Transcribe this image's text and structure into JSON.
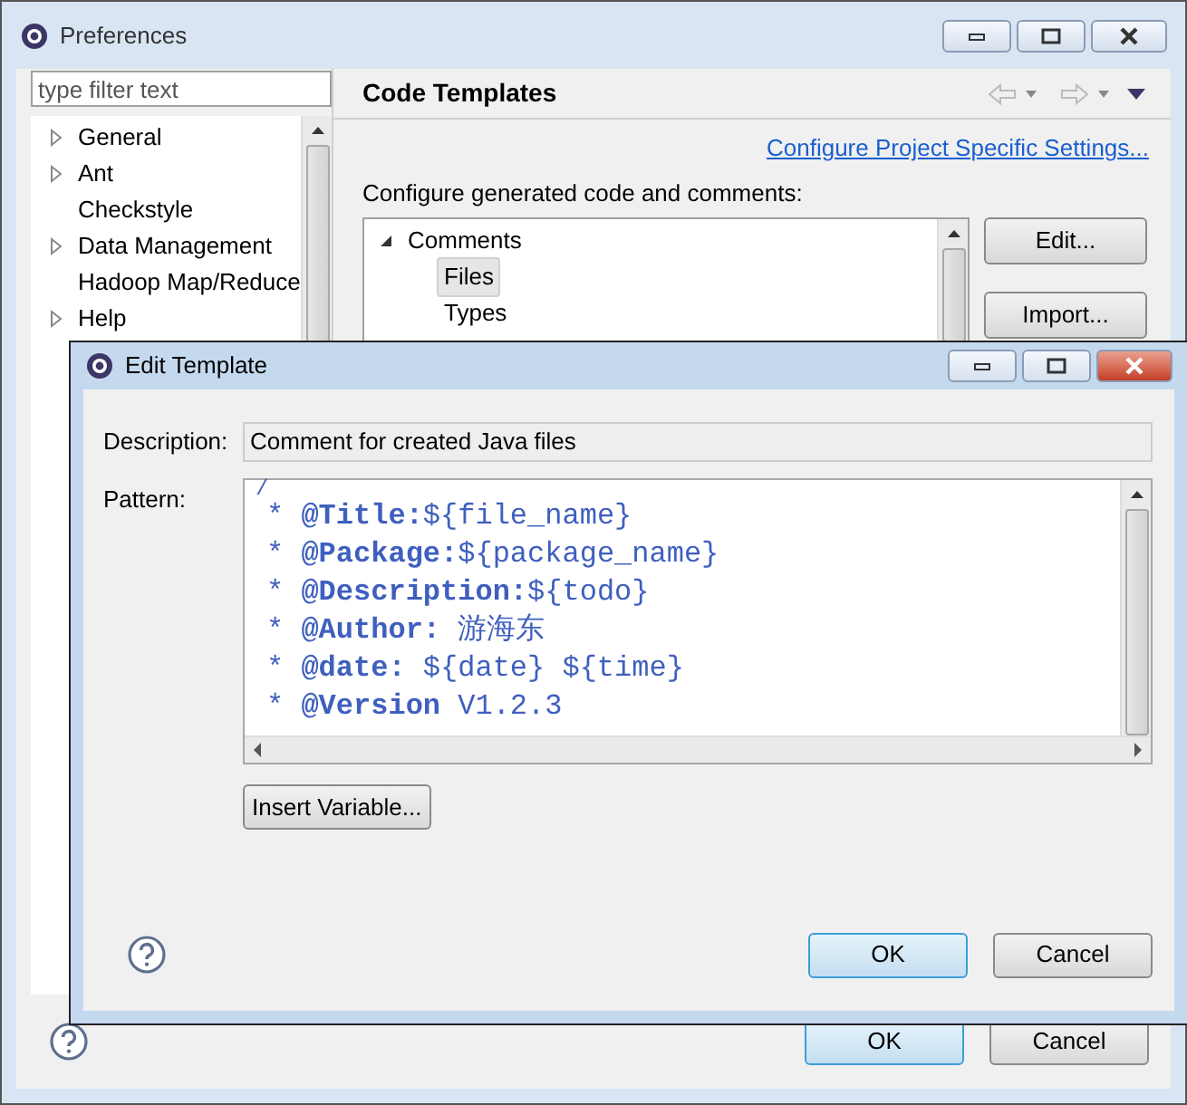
{
  "preferences": {
    "title": "Preferences",
    "filter": {
      "placeholder": "type filter text"
    },
    "tree": [
      {
        "label": "General",
        "expandable": true
      },
      {
        "label": "Ant",
        "expandable": true
      },
      {
        "label": "Checkstyle",
        "expandable": false
      },
      {
        "label": "Data Management",
        "expandable": true
      },
      {
        "label": "Hadoop Map/Reduce",
        "expandable": false
      },
      {
        "label": "Help",
        "expandable": true
      }
    ],
    "page_title": "Code Templates",
    "link": "Configure Project Specific Settings...",
    "intro": "Configure generated code and comments:",
    "templates": [
      {
        "label": "Comments",
        "expanded": true,
        "children": [
          {
            "label": "Files",
            "selected": true
          },
          {
            "label": "Types",
            "selected": false
          }
        ]
      }
    ],
    "side_buttons": [
      "Edit...",
      "Import..."
    ],
    "buttons": [
      {
        "label": "OK",
        "default": true
      },
      {
        "label": "Cancel",
        "default": false
      }
    ]
  },
  "dialog": {
    "title": "Edit Template",
    "description_label": "Description:",
    "description": "Comment for created Java files",
    "pattern_label": "Pattern:",
    "pattern_lines": [
      "/",
      "* **@Title:**${file_name}",
      "* **@Package:**${package_name}",
      "* **@Description:**${todo}",
      "* **@Author:** 游海东",
      "* **@date:** ${date} ${time}",
      "* **@Version** V1.2.3"
    ],
    "insert_button": "Insert Variable...",
    "buttons": [
      {
        "label": "OK",
        "default": true
      },
      {
        "label": "Cancel",
        "default": false
      }
    ]
  }
}
